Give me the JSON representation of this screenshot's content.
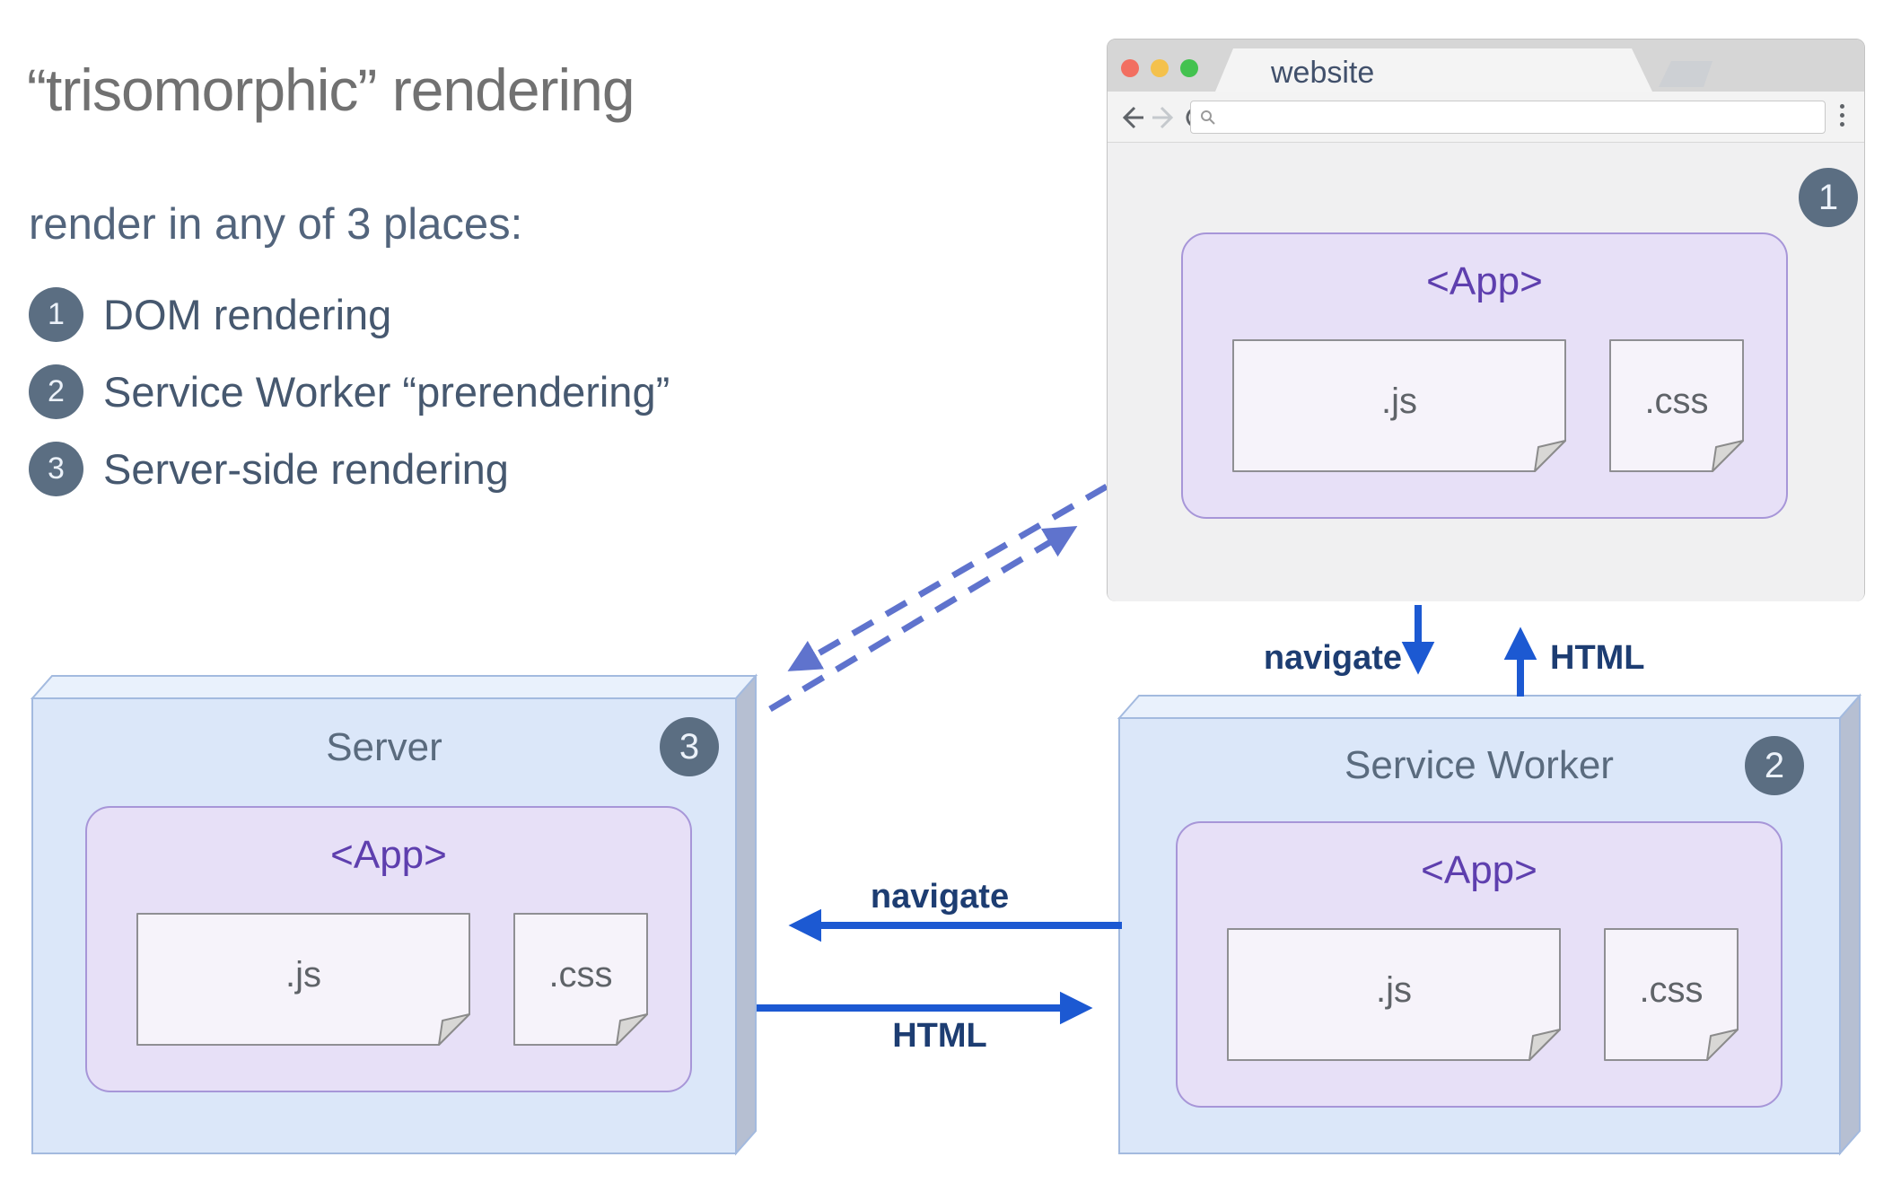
{
  "intro": {
    "title": "“trisomorphic” rendering",
    "subtitle": "render in any of 3 places:",
    "items": [
      {
        "num": "1",
        "label": "DOM rendering"
      },
      {
        "num": "2",
        "label": "Service Worker “prerendering”"
      },
      {
        "num": "3",
        "label": "Server-side rendering"
      }
    ]
  },
  "browser": {
    "tab_title": "website",
    "url_value": "",
    "badge": "1",
    "app": {
      "title": "<App>",
      "files": [
        ".js",
        ".css"
      ]
    }
  },
  "service_worker": {
    "title": "Service Worker",
    "badge": "2",
    "app": {
      "title": "<App>",
      "files": [
        ".js",
        ".css"
      ]
    }
  },
  "server": {
    "title": "Server",
    "badge": "3",
    "app": {
      "title": "<App>",
      "files": [
        ".js",
        ".css"
      ]
    }
  },
  "flows": {
    "navigate_down": "navigate",
    "html_up": "HTML",
    "navigate_left": "navigate",
    "html_right": "HTML"
  },
  "colors": {
    "arrow_blue": "#1c59d2",
    "label_navy": "#1d3d72",
    "dashed_periwinkle": "#5f73cd",
    "badge_bg": "#5b6e82",
    "box_face_blue": "#dbe7f9",
    "box_top_blue": "#e9f1fc",
    "box_side_gray": "#b6bfd2",
    "app_fill_lavender": "#e7e0f7",
    "app_border_purple": "#a796d8",
    "app_text_purple": "#5e3fae",
    "traffic_red": "#f26f61",
    "traffic_yellow": "#f4c14c",
    "traffic_green": "#43c24f"
  }
}
